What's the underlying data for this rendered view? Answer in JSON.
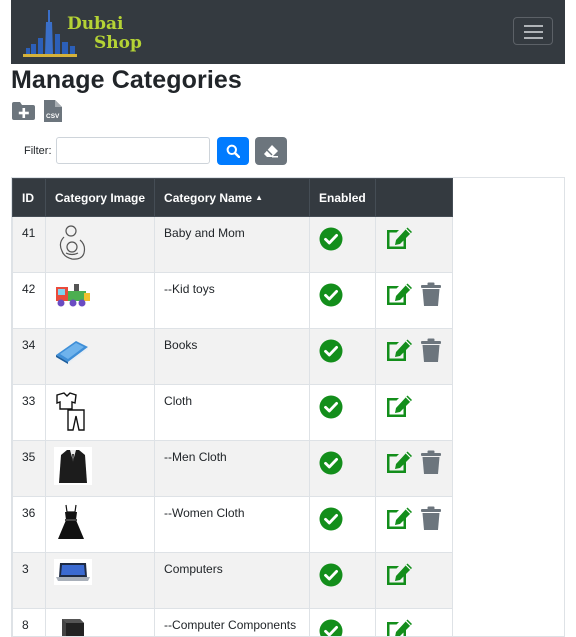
{
  "brand": {
    "line1": "Dubai",
    "line2": "Shop",
    "accent_color": "#b5d335"
  },
  "nav": {
    "toggle_icon": "hamburger-icon"
  },
  "page": {
    "title": "Manage Categories",
    "create_icon": "folder-plus-icon",
    "export_icon": "csv-file-icon",
    "export_badge": "CSV"
  },
  "filter": {
    "label": "Filter:",
    "value": "",
    "search_icon": "search-icon",
    "clear_icon": "eraser-icon"
  },
  "table": {
    "headers": {
      "id": "ID",
      "image": "Category Image",
      "name": "Category Name",
      "enabled": "Enabled",
      "actions": ""
    },
    "sort_icon": "caret-up-icon",
    "rows": [
      {
        "id": "41",
        "name": "Baby and Mom",
        "enabled": true,
        "can_delete": false,
        "image": "baby-mom-icon"
      },
      {
        "id": "42",
        "name": "--Kid toys",
        "enabled": true,
        "can_delete": true,
        "image": "toy-train-icon"
      },
      {
        "id": "34",
        "name": "Books",
        "enabled": true,
        "can_delete": true,
        "image": "book-icon"
      },
      {
        "id": "33",
        "name": "Cloth",
        "enabled": true,
        "can_delete": false,
        "image": "clothes-icon"
      },
      {
        "id": "35",
        "name": "--Men Cloth",
        "enabled": true,
        "can_delete": true,
        "image": "suit-icon"
      },
      {
        "id": "36",
        "name": "--Women Cloth",
        "enabled": true,
        "can_delete": true,
        "image": "dress-icon"
      },
      {
        "id": "3",
        "name": "Computers",
        "enabled": true,
        "can_delete": false,
        "image": "laptop-icon"
      },
      {
        "id": "8",
        "name": "--Computer Components",
        "enabled": true,
        "can_delete": false,
        "image": "computer-case-icon"
      }
    ]
  },
  "colors": {
    "navbar": "#343a40",
    "primary": "#007bff",
    "secondary": "#6c757d",
    "success": "#138e1b",
    "icon_gray": "#6c757d"
  }
}
